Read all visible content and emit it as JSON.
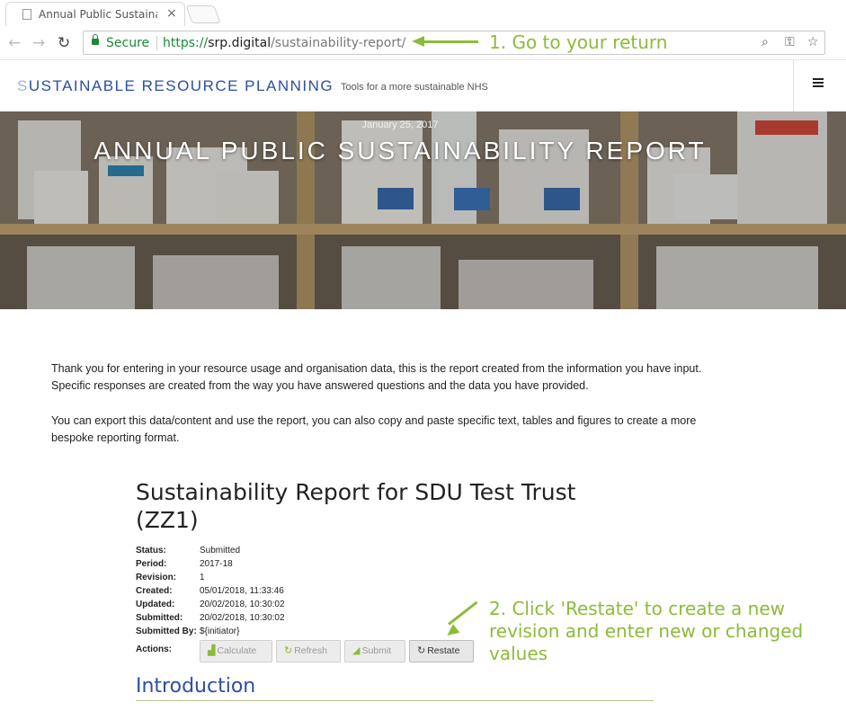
{
  "browser": {
    "tab_title": "Annual Public Sustainab",
    "tab_close": "×",
    "back": "←",
    "forward": "→",
    "reload": "↻",
    "secure_label": "Secure",
    "url_protocol": "https://",
    "url_host": "srp.digital",
    "url_path": "/sustainability-report/",
    "zoom_icon": "⌕",
    "key_icon": "⚿",
    "star_icon": "☆"
  },
  "annotations": {
    "step1": "1. Go to your return",
    "step2": "2. Click 'Restate' to create a new revision and enter new or changed values",
    "color": "#8cbb39"
  },
  "site": {
    "brand_first": "S",
    "brand_rest": "USTAINABLE RESOURCE PLANNING",
    "tagline": "Tools for a more sustainable NHS",
    "menu_icon": "hamburger-icon"
  },
  "hero": {
    "date": "January 25, 2017",
    "title": "ANNUAL PUBLIC SUSTAINABILITY REPORT"
  },
  "intro_paragraphs": {
    "p1": "Thank you for entering in your resource usage and organisation data, this is the report created from the information you have input. Specific responses are created from the way you have answered questions and the data you have provided.",
    "p2": "You can export this data/content and use the report, you can also copy and paste specific text, tables and figures to create a more bespoke reporting format."
  },
  "report": {
    "title": "Sustainability Report for SDU Test Trust (ZZ1)",
    "meta": {
      "status_label": "Status:",
      "status": "Submitted",
      "period_label": "Period:",
      "period": "2017-18",
      "revision_label": "Revision:",
      "revision": "1",
      "created_label": "Created:",
      "created": "05/01/2018, 11:33:46",
      "updated_label": "Updated:",
      "updated": "20/02/2018, 10:30:02",
      "submitted_label": "Submitted:",
      "submitted": "20/02/2018, 10:30:02",
      "submitted_by_label": "Submitted By:",
      "submitted_by": "${initiator}",
      "actions_label": "Actions:"
    },
    "actions": {
      "calculate": "Calculate",
      "refresh": "Refresh",
      "submit": "Submit",
      "restate": "Restate"
    },
    "section_heading": "Introduction"
  },
  "colors": {
    "brand_blue": "#2c4fa3",
    "secure_green": "#1a8a34",
    "annotation_green": "#8cbb39"
  }
}
